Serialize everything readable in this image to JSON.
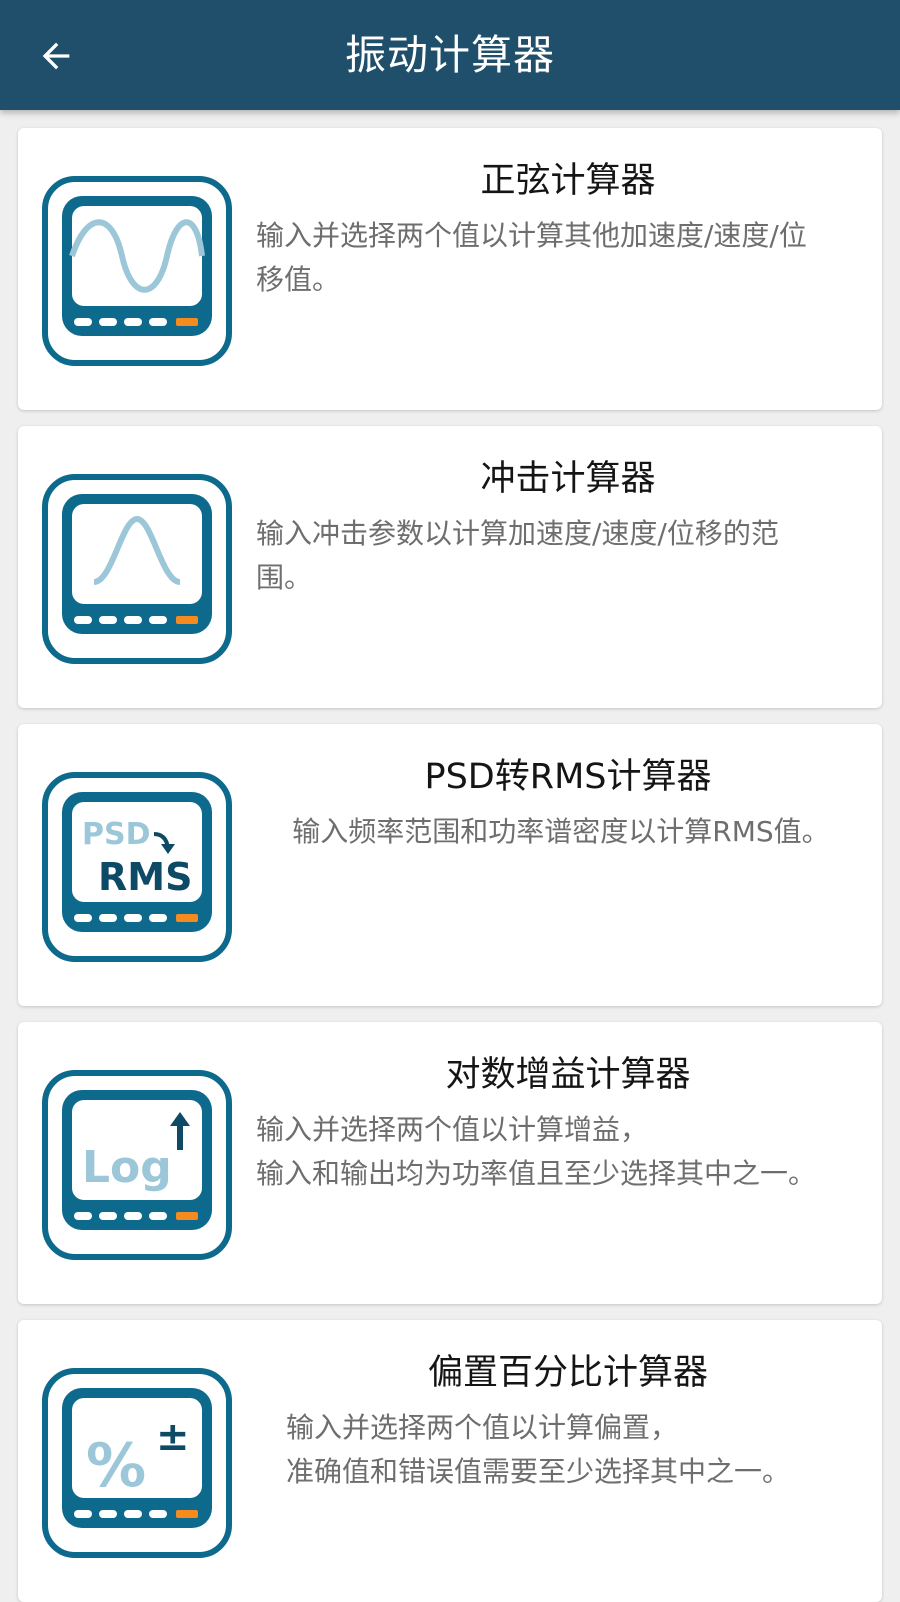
{
  "appbar": {
    "title": "振动计算器",
    "back_icon": "arrow-back-icon"
  },
  "colors": {
    "appbar_bg": "#1f4f6b",
    "icon_teal": "#0d6a8d",
    "icon_orange": "#f58a1f",
    "icon_light": "#9cc7d9"
  },
  "cards": [
    {
      "title": "正弦计算器",
      "description": "输入并选择两个值以计算其他加速度/速度/位\n移值。",
      "icon": "sine-wave-icon"
    },
    {
      "title": "冲击计算器",
      "description": "输入冲击参数以计算加速度/速度/位移的范\n围。",
      "icon": "shock-pulse-icon"
    },
    {
      "title": "PSD转RMS计算器",
      "description": "输入频率范围和功率谱密度以计算RMS值。",
      "icon": "psd-rms-icon",
      "icon_text_top": "PSD",
      "icon_text_bottom": "RMS"
    },
    {
      "title": "对数增益计算器",
      "description": "输入并选择两个值以计算增益，\n输入和输出均为功率值且至少选择其中之一。",
      "icon": "log-gain-icon",
      "icon_text": "Log"
    },
    {
      "title": "偏置百分比计算器",
      "description": "输入并选择两个值以计算偏置，\n准确值和错误值需要至少选择其中之一。",
      "icon": "percent-bias-icon",
      "icon_text": "%",
      "icon_sign": "±"
    }
  ]
}
